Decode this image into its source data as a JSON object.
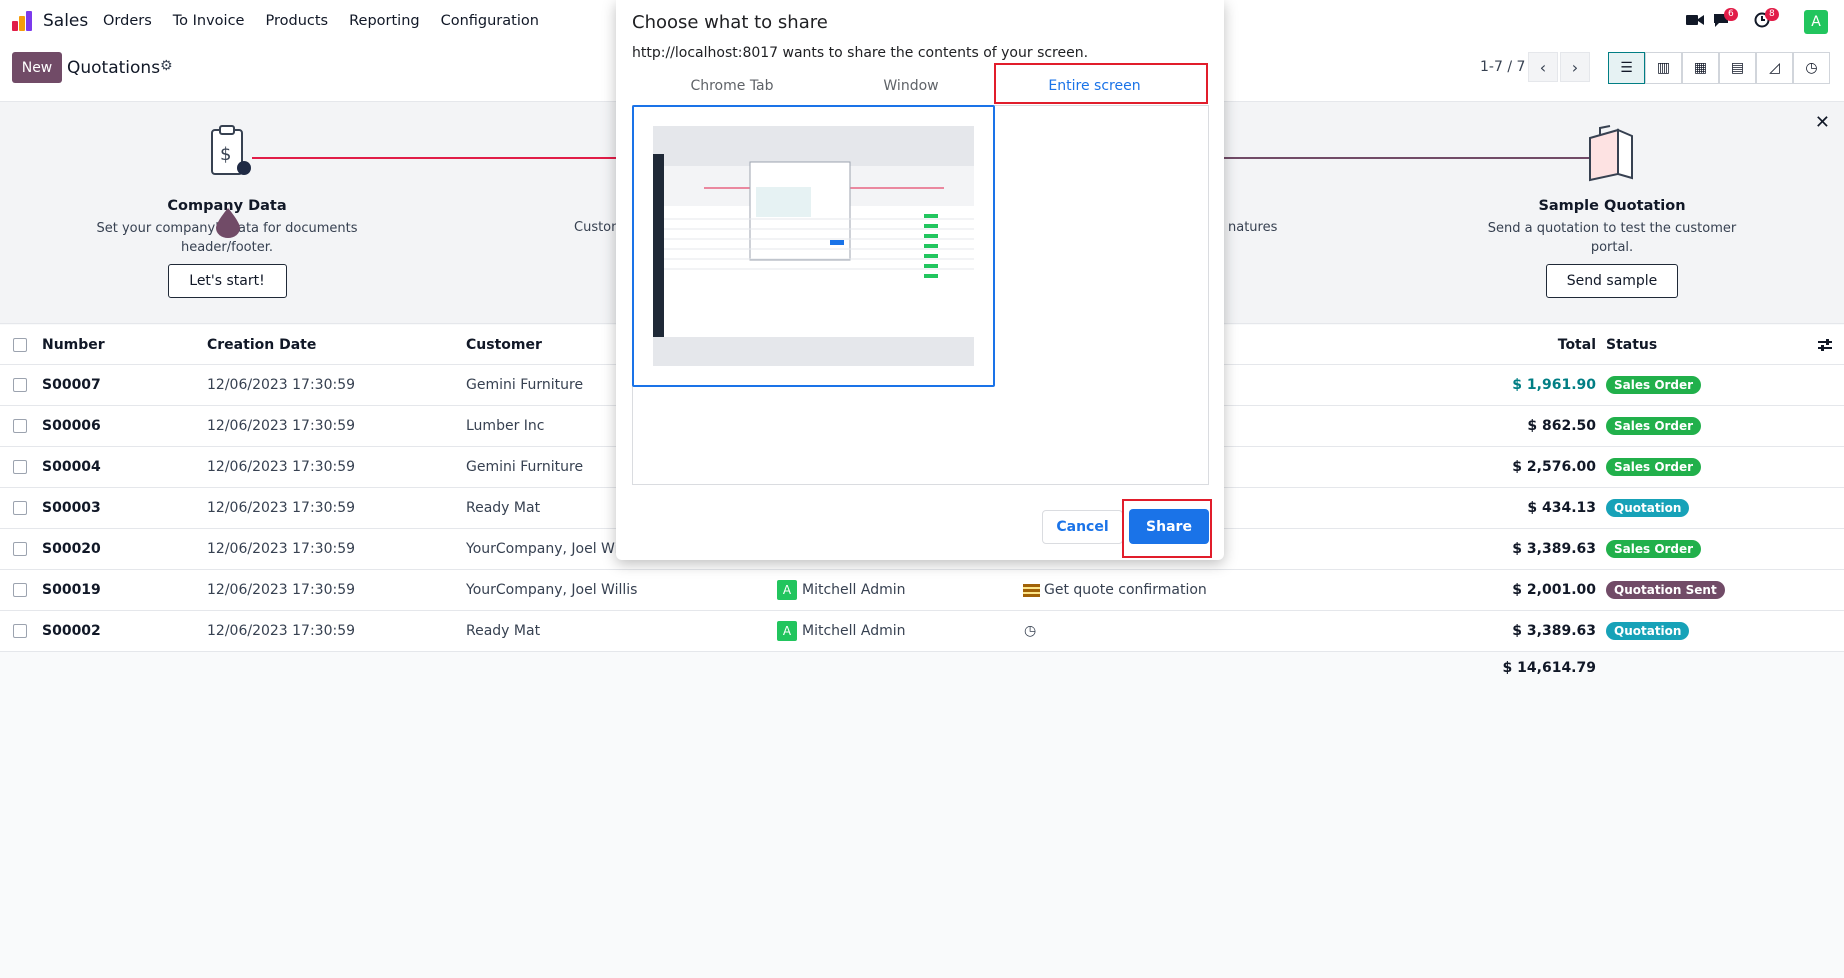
{
  "nav": {
    "app_name": "Sales",
    "menu": [
      "Orders",
      "To Invoice",
      "Products",
      "Reporting",
      "Configuration"
    ],
    "chat_badge": "6",
    "activity_badge": "8",
    "avatar_letter": "A"
  },
  "control": {
    "new_label": "New",
    "title": "Quotations",
    "pager": "1-7 / 7"
  },
  "onboarding": {
    "company": {
      "title": "Company Data",
      "desc": "Set your company's data for documents header/footer.",
      "button": "Let's start!"
    },
    "sample": {
      "title": "Sample Quotation",
      "desc": "Send a quotation to test the customer portal.",
      "button": "Send sample"
    },
    "partial_left": "Custom",
    "partial_right": "natures"
  },
  "table": {
    "headers": {
      "number": "Number",
      "date": "Creation Date",
      "customer": "Customer",
      "total": "Total",
      "status": "Status"
    },
    "rows": [
      {
        "number": "S00007",
        "date": "12/06/2023 17:30:59",
        "customer": "Gemini Furniture",
        "salesperson": "",
        "activity": "",
        "total": "$ 1,961.90",
        "status": "Sales Order"
      },
      {
        "number": "S00006",
        "date": "12/06/2023 17:30:59",
        "customer": "Lumber Inc",
        "salesperson": "",
        "activity": "",
        "total": "$ 862.50",
        "status": "Sales Order"
      },
      {
        "number": "S00004",
        "date": "12/06/2023 17:30:59",
        "customer": "Gemini Furniture",
        "salesperson": "",
        "activity": "",
        "total": "$ 2,576.00",
        "status": "Sales Order"
      },
      {
        "number": "S00003",
        "date": "12/06/2023 17:30:59",
        "customer": "Ready Mat",
        "salesperson": "",
        "activity": "",
        "total": "$ 434.13",
        "status": "Quotation"
      },
      {
        "number": "S00020",
        "date": "12/06/2023 17:30:59",
        "customer": "YourCompany, Joel Willis",
        "salesperson": "",
        "activity": "",
        "total": "$ 3,389.63",
        "status": "Sales Order"
      },
      {
        "number": "S00019",
        "date": "12/06/2023 17:30:59",
        "customer": "YourCompany, Joel Willis",
        "salesperson": "Mitchell Admin",
        "activity": "Get quote confirmation",
        "total": "$ 2,001.00",
        "status": "Quotation Sent"
      },
      {
        "number": "S00002",
        "date": "12/06/2023 17:30:59",
        "customer": "Ready Mat",
        "salesperson": "Mitchell Admin",
        "activity": "",
        "total": "$ 3,389.63",
        "status": "Quotation"
      }
    ],
    "grand_total": "$ 14,614.79"
  },
  "status_colors": {
    "Sales Order": "#21b04b",
    "Quotation": "#17a2b8",
    "Quotation Sent": "#714b67"
  },
  "dialog": {
    "title": "Choose what to share",
    "subtitle": "http://localhost:8017 wants to share the contents of your screen.",
    "tabs": [
      "Chrome Tab",
      "Window",
      "Entire screen"
    ],
    "active_tab": "Entire screen",
    "cancel": "Cancel",
    "share": "Share"
  }
}
